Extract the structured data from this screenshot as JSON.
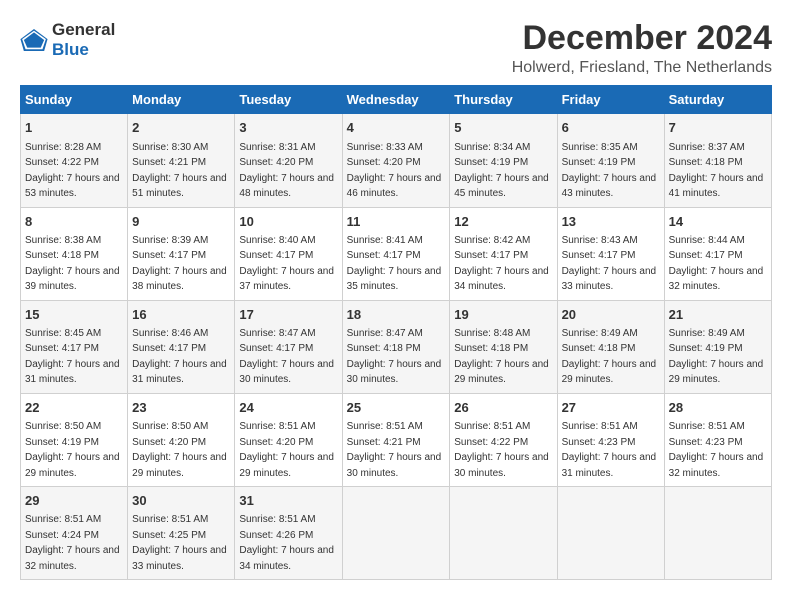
{
  "logo": {
    "general": "General",
    "blue": "Blue"
  },
  "title": "December 2024",
  "subtitle": "Holwerd, Friesland, The Netherlands",
  "days_of_week": [
    "Sunday",
    "Monday",
    "Tuesday",
    "Wednesday",
    "Thursday",
    "Friday",
    "Saturday"
  ],
  "weeks": [
    [
      {
        "day": 1,
        "sunrise": "Sunrise: 8:28 AM",
        "sunset": "Sunset: 4:22 PM",
        "daylight": "Daylight: 7 hours and 53 minutes."
      },
      {
        "day": 2,
        "sunrise": "Sunrise: 8:30 AM",
        "sunset": "Sunset: 4:21 PM",
        "daylight": "Daylight: 7 hours and 51 minutes."
      },
      {
        "day": 3,
        "sunrise": "Sunrise: 8:31 AM",
        "sunset": "Sunset: 4:20 PM",
        "daylight": "Daylight: 7 hours and 48 minutes."
      },
      {
        "day": 4,
        "sunrise": "Sunrise: 8:33 AM",
        "sunset": "Sunset: 4:20 PM",
        "daylight": "Daylight: 7 hours and 46 minutes."
      },
      {
        "day": 5,
        "sunrise": "Sunrise: 8:34 AM",
        "sunset": "Sunset: 4:19 PM",
        "daylight": "Daylight: 7 hours and 45 minutes."
      },
      {
        "day": 6,
        "sunrise": "Sunrise: 8:35 AM",
        "sunset": "Sunset: 4:19 PM",
        "daylight": "Daylight: 7 hours and 43 minutes."
      },
      {
        "day": 7,
        "sunrise": "Sunrise: 8:37 AM",
        "sunset": "Sunset: 4:18 PM",
        "daylight": "Daylight: 7 hours and 41 minutes."
      }
    ],
    [
      {
        "day": 8,
        "sunrise": "Sunrise: 8:38 AM",
        "sunset": "Sunset: 4:18 PM",
        "daylight": "Daylight: 7 hours and 39 minutes."
      },
      {
        "day": 9,
        "sunrise": "Sunrise: 8:39 AM",
        "sunset": "Sunset: 4:17 PM",
        "daylight": "Daylight: 7 hours and 38 minutes."
      },
      {
        "day": 10,
        "sunrise": "Sunrise: 8:40 AM",
        "sunset": "Sunset: 4:17 PM",
        "daylight": "Daylight: 7 hours and 37 minutes."
      },
      {
        "day": 11,
        "sunrise": "Sunrise: 8:41 AM",
        "sunset": "Sunset: 4:17 PM",
        "daylight": "Daylight: 7 hours and 35 minutes."
      },
      {
        "day": 12,
        "sunrise": "Sunrise: 8:42 AM",
        "sunset": "Sunset: 4:17 PM",
        "daylight": "Daylight: 7 hours and 34 minutes."
      },
      {
        "day": 13,
        "sunrise": "Sunrise: 8:43 AM",
        "sunset": "Sunset: 4:17 PM",
        "daylight": "Daylight: 7 hours and 33 minutes."
      },
      {
        "day": 14,
        "sunrise": "Sunrise: 8:44 AM",
        "sunset": "Sunset: 4:17 PM",
        "daylight": "Daylight: 7 hours and 32 minutes."
      }
    ],
    [
      {
        "day": 15,
        "sunrise": "Sunrise: 8:45 AM",
        "sunset": "Sunset: 4:17 PM",
        "daylight": "Daylight: 7 hours and 31 minutes."
      },
      {
        "day": 16,
        "sunrise": "Sunrise: 8:46 AM",
        "sunset": "Sunset: 4:17 PM",
        "daylight": "Daylight: 7 hours and 31 minutes."
      },
      {
        "day": 17,
        "sunrise": "Sunrise: 8:47 AM",
        "sunset": "Sunset: 4:17 PM",
        "daylight": "Daylight: 7 hours and 30 minutes."
      },
      {
        "day": 18,
        "sunrise": "Sunrise: 8:47 AM",
        "sunset": "Sunset: 4:18 PM",
        "daylight": "Daylight: 7 hours and 30 minutes."
      },
      {
        "day": 19,
        "sunrise": "Sunrise: 8:48 AM",
        "sunset": "Sunset: 4:18 PM",
        "daylight": "Daylight: 7 hours and 29 minutes."
      },
      {
        "day": 20,
        "sunrise": "Sunrise: 8:49 AM",
        "sunset": "Sunset: 4:18 PM",
        "daylight": "Daylight: 7 hours and 29 minutes."
      },
      {
        "day": 21,
        "sunrise": "Sunrise: 8:49 AM",
        "sunset": "Sunset: 4:19 PM",
        "daylight": "Daylight: 7 hours and 29 minutes."
      }
    ],
    [
      {
        "day": 22,
        "sunrise": "Sunrise: 8:50 AM",
        "sunset": "Sunset: 4:19 PM",
        "daylight": "Daylight: 7 hours and 29 minutes."
      },
      {
        "day": 23,
        "sunrise": "Sunrise: 8:50 AM",
        "sunset": "Sunset: 4:20 PM",
        "daylight": "Daylight: 7 hours and 29 minutes."
      },
      {
        "day": 24,
        "sunrise": "Sunrise: 8:51 AM",
        "sunset": "Sunset: 4:20 PM",
        "daylight": "Daylight: 7 hours and 29 minutes."
      },
      {
        "day": 25,
        "sunrise": "Sunrise: 8:51 AM",
        "sunset": "Sunset: 4:21 PM",
        "daylight": "Daylight: 7 hours and 30 minutes."
      },
      {
        "day": 26,
        "sunrise": "Sunrise: 8:51 AM",
        "sunset": "Sunset: 4:22 PM",
        "daylight": "Daylight: 7 hours and 30 minutes."
      },
      {
        "day": 27,
        "sunrise": "Sunrise: 8:51 AM",
        "sunset": "Sunset: 4:23 PM",
        "daylight": "Daylight: 7 hours and 31 minutes."
      },
      {
        "day": 28,
        "sunrise": "Sunrise: 8:51 AM",
        "sunset": "Sunset: 4:23 PM",
        "daylight": "Daylight: 7 hours and 32 minutes."
      }
    ],
    [
      {
        "day": 29,
        "sunrise": "Sunrise: 8:51 AM",
        "sunset": "Sunset: 4:24 PM",
        "daylight": "Daylight: 7 hours and 32 minutes."
      },
      {
        "day": 30,
        "sunrise": "Sunrise: 8:51 AM",
        "sunset": "Sunset: 4:25 PM",
        "daylight": "Daylight: 7 hours and 33 minutes."
      },
      {
        "day": 31,
        "sunrise": "Sunrise: 8:51 AM",
        "sunset": "Sunset: 4:26 PM",
        "daylight": "Daylight: 7 hours and 34 minutes."
      },
      null,
      null,
      null,
      null
    ]
  ]
}
